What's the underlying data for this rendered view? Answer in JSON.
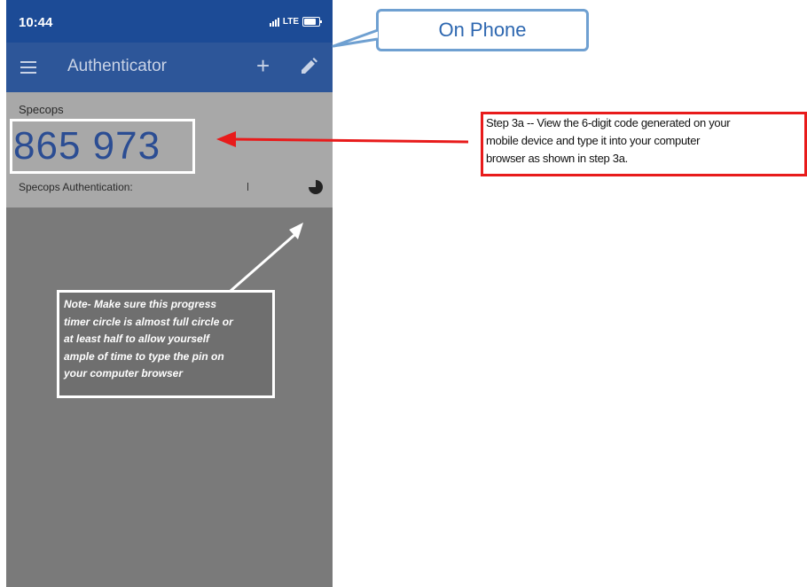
{
  "status_bar": {
    "time": "10:44",
    "network": "LTE"
  },
  "app_bar": {
    "title": "Authenticator",
    "icons": [
      "menu-icon",
      "add-icon",
      "edit-icon"
    ]
  },
  "account": {
    "issuer": "Specops",
    "code": "865 973",
    "name": "Specops Authentication:"
  },
  "annotations": {
    "callout": "On Phone",
    "step": "Step 3a -- View the 6-digit code generated on your\nmobile device and type it into your computer\nbrowser as shown in step 3a.",
    "note": "Note- Make sure this progress\ntimer circle is almost full circle or\nat least half to allow yourself\nample of time to type the pin on\nyour computer browser"
  },
  "colors": {
    "status_bar": "#1c4b96",
    "app_bar": "#2d5699",
    "code": "#2b4d93",
    "step_border": "#e81b1b",
    "callout_border": "#6fa0d1"
  }
}
